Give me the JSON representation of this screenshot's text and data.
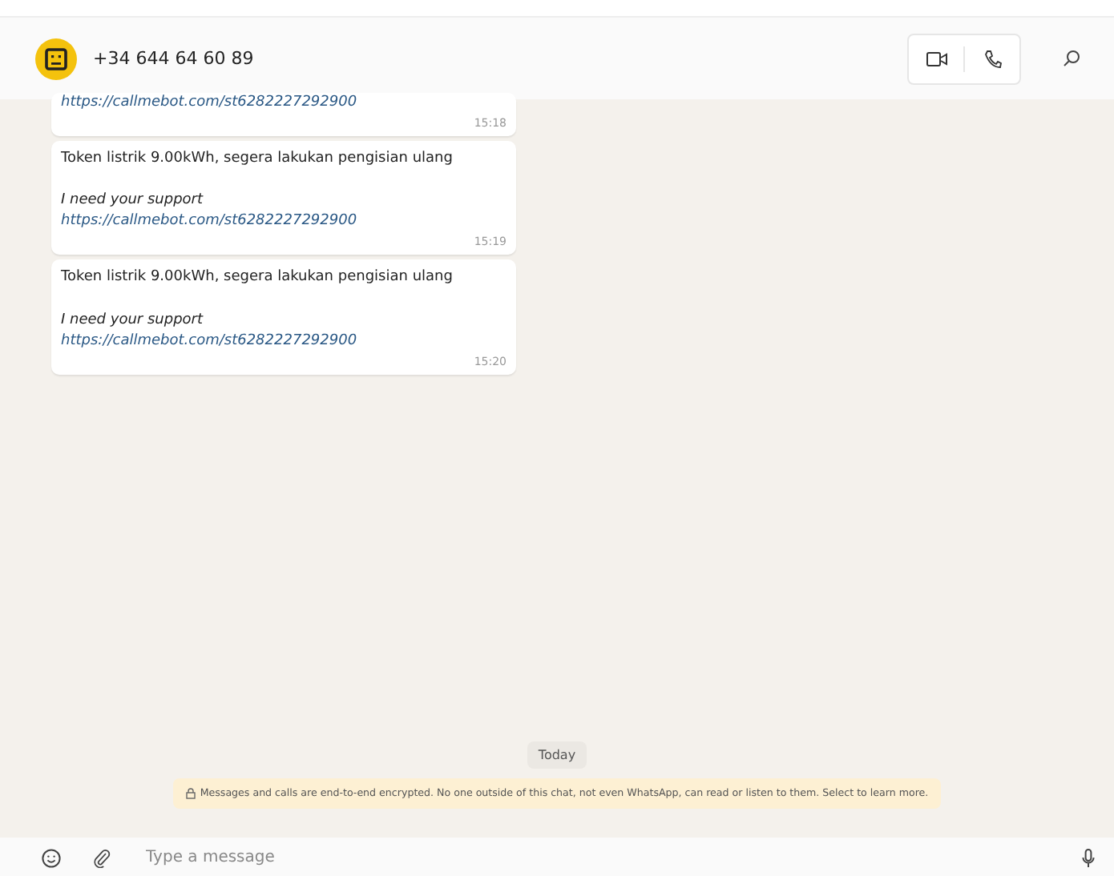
{
  "header": {
    "contact": "+34 644 64 60 89"
  },
  "messages": [
    {
      "kind": "partial",
      "link": "https://callmebot.com/st6282227292900",
      "time": "15:18"
    },
    {
      "kind": "full",
      "text": "Token listrik 9.00kWh, segera lakukan pengisian ulang",
      "italic": "I need your support",
      "link": "https://callmebot.com/st6282227292900",
      "time": "15:19"
    },
    {
      "kind": "full",
      "text": "Token listrik 9.00kWh, segera lakukan pengisian ulang",
      "italic": "I need your support",
      "link": "https://callmebot.com/st6282227292900",
      "time": "15:20"
    }
  ],
  "date_chip": "Today",
  "encryption_notice": "Messages and calls are end-to-end encrypted. No one outside of this chat, not even WhatsApp, can read or listen to them. Select to learn more.",
  "composer": {
    "placeholder": "Type a message"
  }
}
